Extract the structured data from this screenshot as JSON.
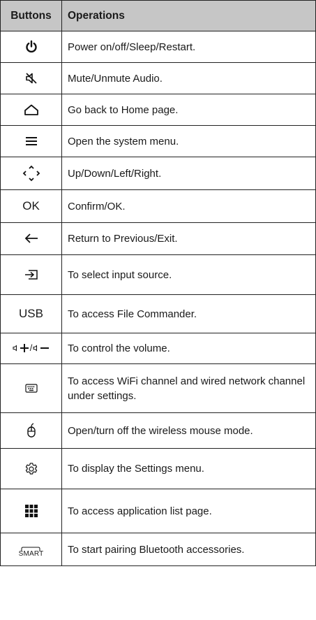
{
  "header": {
    "buttons": "Buttons",
    "operations": "Operations"
  },
  "rows": [
    {
      "icon": "power-icon",
      "operation": "Power on/off/Sleep/Restart."
    },
    {
      "icon": "mute-icon",
      "operation": "Mute/Unmute Audio."
    },
    {
      "icon": "home-icon",
      "operation": "Go back to Home page."
    },
    {
      "icon": "menu-icon",
      "operation": "Open the system menu."
    },
    {
      "icon": "navigation-arrows-icon",
      "operation": "Up/Down/Left/Right."
    },
    {
      "label": "OK",
      "operation": "Confirm/OK."
    },
    {
      "icon": "back-arrow-icon",
      "operation": "Return to Previous/Exit."
    },
    {
      "icon": "input-source-icon",
      "operation": "To select input source."
    },
    {
      "label": "USB",
      "operation": "To access File Commander."
    },
    {
      "icon": "volume-icon",
      "label": "+/",
      "operation": "To control the volume."
    },
    {
      "icon": "keyboard-icon",
      "operation": "To access WiFi channel and wired network channel under settings."
    },
    {
      "icon": "mouse-icon",
      "operation": "Open/turn off the wireless mouse mode."
    },
    {
      "icon": "gear-icon",
      "operation": "To display the Settings menu."
    },
    {
      "icon": "apps-grid-icon",
      "operation": "To access application list page."
    },
    {
      "icon": "smart-icon",
      "label": "SMART",
      "operation": "To start pairing Bluetooth accessories."
    }
  ]
}
